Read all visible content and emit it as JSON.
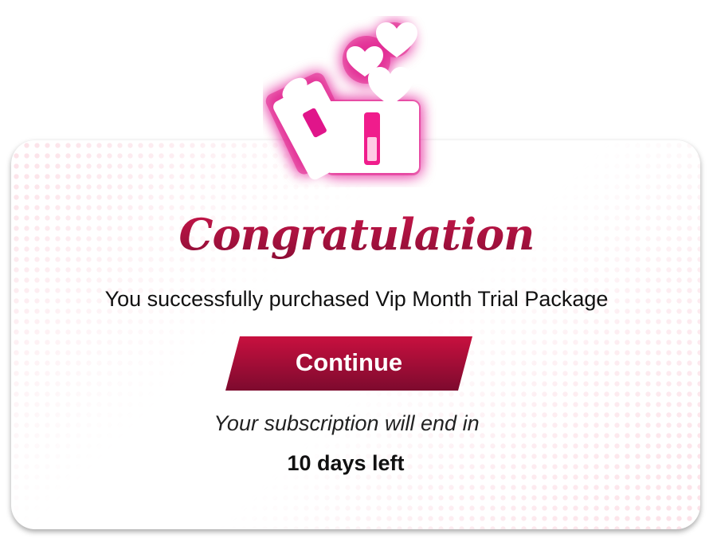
{
  "dialog": {
    "title": "Congratulation",
    "message": "You successfully purchased Vip Month Trial Package",
    "continue_label": "Continue",
    "end_note": "Your subscription will end in",
    "days_left": "10 days left"
  },
  "icons": {
    "header": "gift-box-hearts-icon"
  },
  "colors": {
    "accent": "#c3123f",
    "accent_dark": "#7d0a2e",
    "gift_glow": "#e0188a",
    "pattern_dots": "#f07896"
  }
}
